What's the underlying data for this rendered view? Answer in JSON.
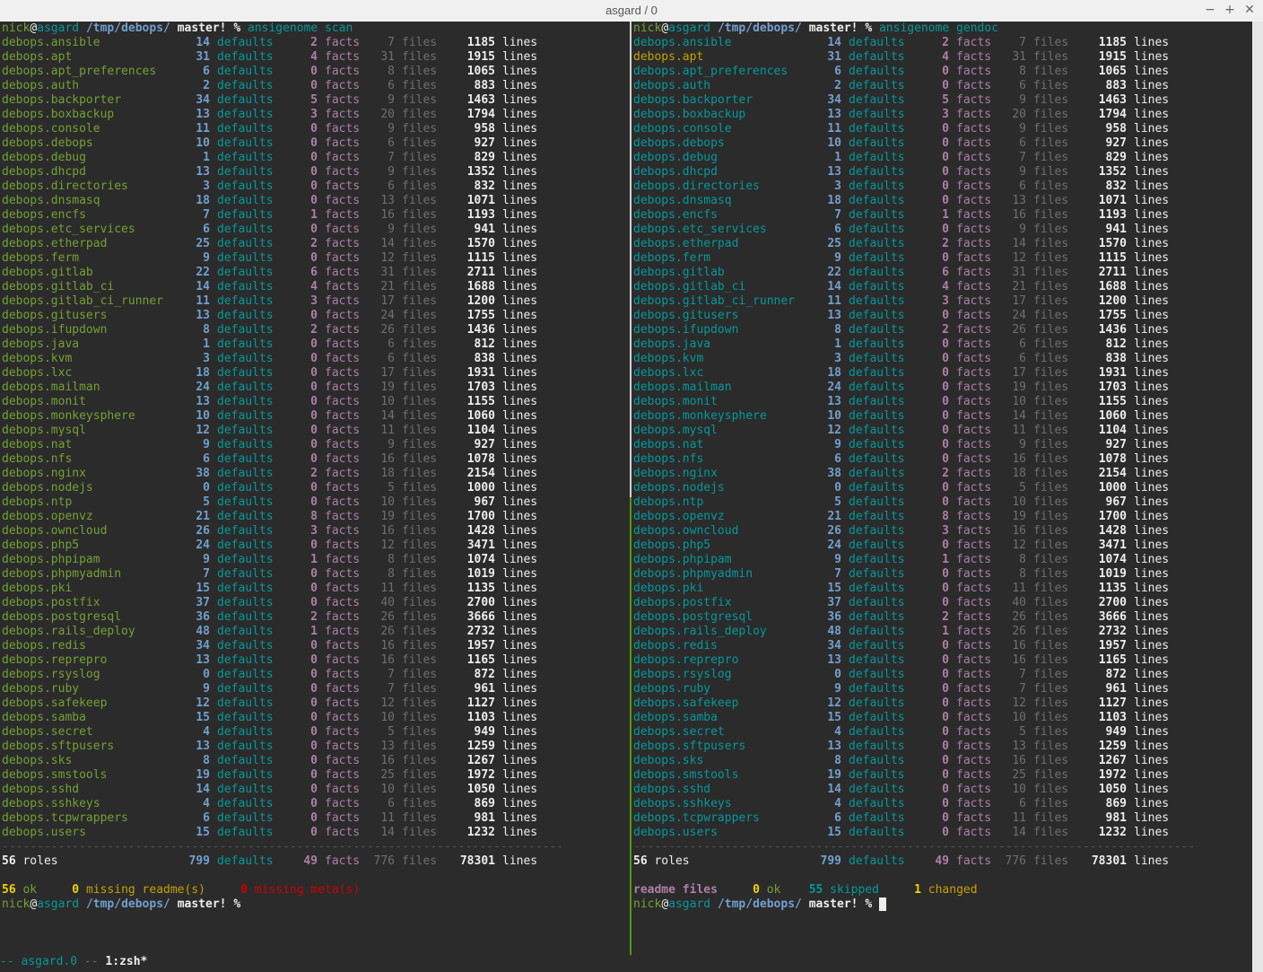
{
  "window": {
    "title": "asgard / 0",
    "minimize_label": "−",
    "maximize_label": "+",
    "close_label": "✕"
  },
  "prompt": {
    "user": "nick",
    "at": "@",
    "host": "asgard",
    "path": "/tmp/debops/",
    "branch": "master!",
    "symbol": "%"
  },
  "left_pane": {
    "command": "ansigenome scan",
    "roles": [
      [
        "debops.ansible",
        "14",
        "2",
        "7",
        "1185"
      ],
      [
        "debops.apt",
        "31",
        "4",
        "31",
        "1915"
      ],
      [
        "debops.apt_preferences",
        "6",
        "0",
        "8",
        "1065"
      ],
      [
        "debops.auth",
        "2",
        "0",
        "6",
        "883"
      ],
      [
        "debops.backporter",
        "34",
        "5",
        "9",
        "1463"
      ],
      [
        "debops.boxbackup",
        "13",
        "3",
        "20",
        "1794"
      ],
      [
        "debops.console",
        "11",
        "0",
        "9",
        "958"
      ],
      [
        "debops.debops",
        "10",
        "0",
        "6",
        "927"
      ],
      [
        "debops.debug",
        "1",
        "0",
        "7",
        "829"
      ],
      [
        "debops.dhcpd",
        "13",
        "0",
        "9",
        "1352"
      ],
      [
        "debops.directories",
        "3",
        "0",
        "6",
        "832"
      ],
      [
        "debops.dnsmasq",
        "18",
        "0",
        "13",
        "1071"
      ],
      [
        "debops.encfs",
        "7",
        "1",
        "16",
        "1193"
      ],
      [
        "debops.etc_services",
        "6",
        "0",
        "9",
        "941"
      ],
      [
        "debops.etherpad",
        "25",
        "2",
        "14",
        "1570"
      ],
      [
        "debops.ferm",
        "9",
        "0",
        "12",
        "1115"
      ],
      [
        "debops.gitlab",
        "22",
        "6",
        "31",
        "2711"
      ],
      [
        "debops.gitlab_ci",
        "14",
        "4",
        "21",
        "1688"
      ],
      [
        "debops.gitlab_ci_runner",
        "11",
        "3",
        "17",
        "1200"
      ],
      [
        "debops.gitusers",
        "13",
        "0",
        "24",
        "1755"
      ],
      [
        "debops.ifupdown",
        "8",
        "2",
        "26",
        "1436"
      ],
      [
        "debops.java",
        "1",
        "0",
        "6",
        "812"
      ],
      [
        "debops.kvm",
        "3",
        "0",
        "6",
        "838"
      ],
      [
        "debops.lxc",
        "18",
        "0",
        "17",
        "1931"
      ],
      [
        "debops.mailman",
        "24",
        "0",
        "19",
        "1703"
      ],
      [
        "debops.monit",
        "13",
        "0",
        "10",
        "1155"
      ],
      [
        "debops.monkeysphere",
        "10",
        "0",
        "14",
        "1060"
      ],
      [
        "debops.mysql",
        "12",
        "0",
        "11",
        "1104"
      ],
      [
        "debops.nat",
        "9",
        "0",
        "9",
        "927"
      ],
      [
        "debops.nfs",
        "6",
        "0",
        "16",
        "1078"
      ],
      [
        "debops.nginx",
        "38",
        "2",
        "18",
        "2154"
      ],
      [
        "debops.nodejs",
        "0",
        "0",
        "5",
        "1000"
      ],
      [
        "debops.ntp",
        "5",
        "0",
        "10",
        "967"
      ],
      [
        "debops.openvz",
        "21",
        "8",
        "19",
        "1700"
      ],
      [
        "debops.owncloud",
        "26",
        "3",
        "16",
        "1428"
      ],
      [
        "debops.php5",
        "24",
        "0",
        "12",
        "3471"
      ],
      [
        "debops.phpipam",
        "9",
        "1",
        "8",
        "1074"
      ],
      [
        "debops.phpmyadmin",
        "7",
        "0",
        "8",
        "1019"
      ],
      [
        "debops.pki",
        "15",
        "0",
        "11",
        "1135"
      ],
      [
        "debops.postfix",
        "37",
        "0",
        "40",
        "2700"
      ],
      [
        "debops.postgresql",
        "36",
        "2",
        "26",
        "3666"
      ],
      [
        "debops.rails_deploy",
        "48",
        "1",
        "26",
        "2732"
      ],
      [
        "debops.redis",
        "34",
        "0",
        "16",
        "1957"
      ],
      [
        "debops.reprepro",
        "13",
        "0",
        "16",
        "1165"
      ],
      [
        "debops.rsyslog",
        "0",
        "0",
        "7",
        "872"
      ],
      [
        "debops.ruby",
        "9",
        "0",
        "7",
        "961"
      ],
      [
        "debops.safekeep",
        "12",
        "0",
        "12",
        "1127"
      ],
      [
        "debops.samba",
        "15",
        "0",
        "10",
        "1103"
      ],
      [
        "debops.secret",
        "4",
        "0",
        "5",
        "949"
      ],
      [
        "debops.sftpusers",
        "13",
        "0",
        "13",
        "1259"
      ],
      [
        "debops.sks",
        "8",
        "0",
        "16",
        "1267"
      ],
      [
        "debops.smstools",
        "19",
        "0",
        "25",
        "1972"
      ],
      [
        "debops.sshd",
        "14",
        "0",
        "10",
        "1050"
      ],
      [
        "debops.sshkeys",
        "4",
        "0",
        "6",
        "869"
      ],
      [
        "debops.tcpwrappers",
        "6",
        "0",
        "11",
        "981"
      ],
      [
        "debops.users",
        "15",
        "0",
        "14",
        "1232"
      ]
    ],
    "separator": "--------------------------------------------------------------------------------",
    "totals": {
      "roles": "56",
      "roles_label": "roles",
      "defaults": "799",
      "facts": "49",
      "files": "776",
      "lines": "78301"
    },
    "summary": {
      "ok_count": "56",
      "ok_label": "ok",
      "readme_count": "0",
      "readme_label": "missing readme(s)",
      "meta_count": "0",
      "meta_label": "missing meta(s)"
    }
  },
  "right_pane": {
    "command": "ansigenome gendoc",
    "highlighted_role": "debops.apt",
    "summary": {
      "readme_label": "readme files",
      "ok_count": "0",
      "ok_label": "ok",
      "skipped_count": "55",
      "skipped_label": "skipped",
      "changed_count": "1",
      "changed_label": "changed"
    }
  },
  "labels": {
    "defaults": "defaults",
    "facts": "facts",
    "files": "files",
    "lines": "lines"
  },
  "statusbar": {
    "prefix": "-- ",
    "session": "asgard.0",
    "middle": " -- ",
    "window": "1:zsh*"
  },
  "colors": {
    "background": "#2b2b2b",
    "role_green": "#73a135",
    "role_cyan": "#06989a",
    "highlight": "#c4a000",
    "count_blue": "#729fcf",
    "facts_purple": "#ad7fa8",
    "muted_grey": "#6f6f6f",
    "error_red": "#cc0000",
    "pane_border_green": "#4e9a06"
  }
}
